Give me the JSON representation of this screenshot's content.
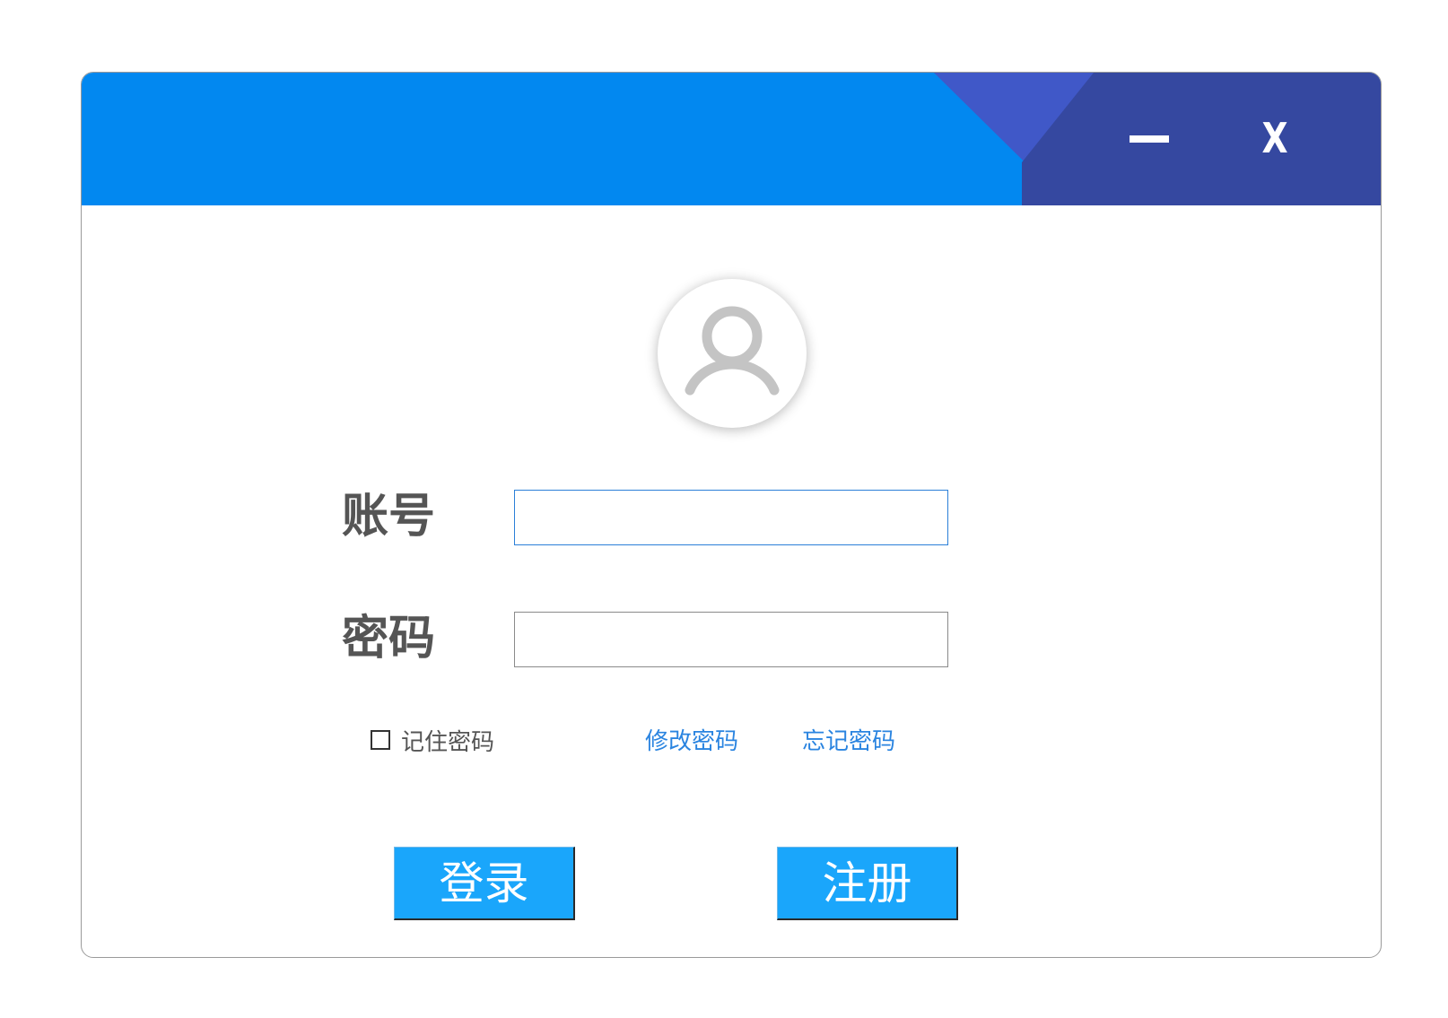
{
  "window": {
    "colors": {
      "titlebar": "#0288f0",
      "accent_dark": "#3548a0",
      "accent_mid": "#4058c8",
      "button": "#1aa6fb",
      "link": "#2a84e0"
    },
    "minimize_icon": "minimize-icon",
    "close_label": "X"
  },
  "avatar": {
    "icon": "user-icon"
  },
  "form": {
    "account_label": "账号",
    "account_value": "",
    "password_label": "密码",
    "password_value": "",
    "remember_label": "记住密码",
    "remember_checked": false,
    "change_password_link": "修改密码",
    "forgot_password_link": "忘记密码"
  },
  "actions": {
    "login_label": "登录",
    "register_label": "注册"
  }
}
